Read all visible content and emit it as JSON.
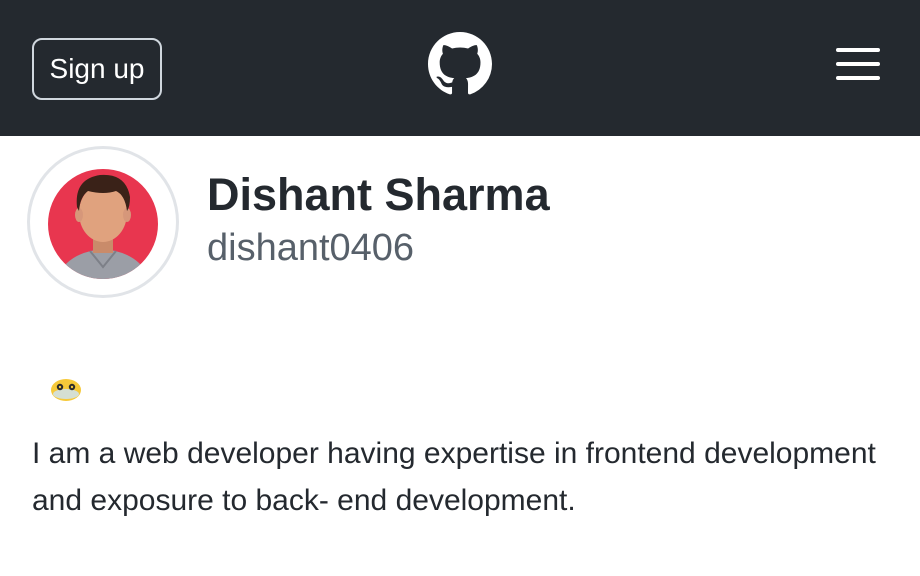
{
  "header": {
    "signup_label": "Sign up",
    "logo_icon": "github-icon",
    "menu_icon": "hamburger-menu-icon",
    "background": "#24292f"
  },
  "profile": {
    "name": "Dishant Sharma",
    "username": "dishant0406",
    "avatar_icon": "avatar-illustration",
    "avatar_bg": "#e8364f",
    "status_emoji_icon": "face-with-spiral-eyes-emoji",
    "bio": "I am a web developer having expertise in frontend development and exposure to back- end development."
  }
}
